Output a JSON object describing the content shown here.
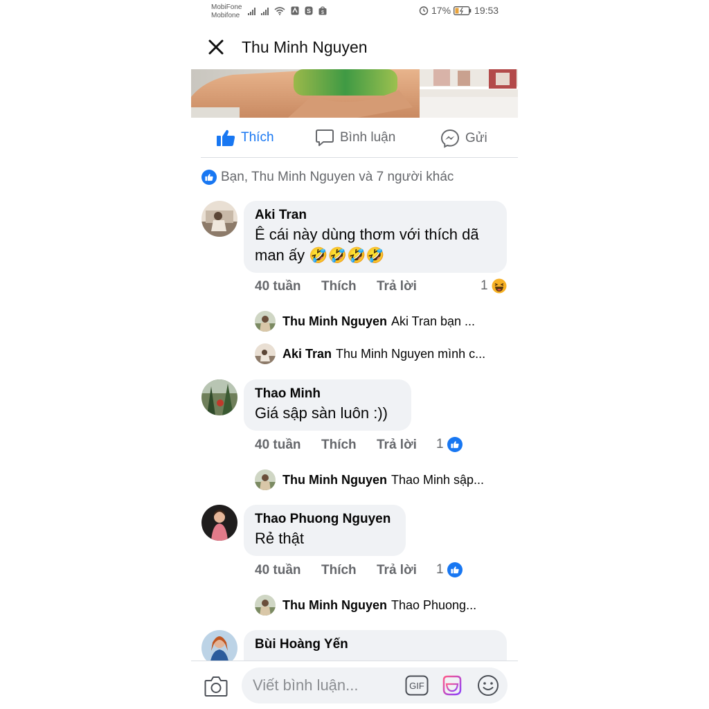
{
  "status_bar": {
    "carrier_1": "MobiFone",
    "carrier_2": "Mobifone",
    "battery": "17%",
    "time": "19:53"
  },
  "header": {
    "title": "Thu Minh Nguyen",
    "close_icon": "close-icon"
  },
  "actions": {
    "like": "Thích",
    "comment": "Bình luận",
    "send": "Gửi"
  },
  "likes_summary": "Bạn, Thu Minh Nguyen và 7 người khác",
  "comments": [
    {
      "author": "Aki Tran",
      "text": "Ê cái này dùng thơm với thích dã man ấy 🤣🤣🤣🤣",
      "time": "40 tuần",
      "like": "Thích",
      "reply": "Trả lời",
      "reaction_count": "1",
      "reaction": "haha",
      "replies": [
        {
          "author": "Thu Minh Nguyen",
          "preview": "Aki Tran  bạn ..."
        },
        {
          "author": "Aki Tran",
          "preview": "Thu Minh Nguyen mình c..."
        }
      ]
    },
    {
      "author": "Thao Minh",
      "text": "Giá sập sàn luôn :))",
      "time": "40 tuần",
      "like": "Thích",
      "reply": "Trả lời",
      "reaction_count": "1",
      "reaction": "like",
      "replies": [
        {
          "author": "Thu Minh Nguyen",
          "preview": "Thao Minh sập..."
        }
      ]
    },
    {
      "author": "Thao Phuong Nguyen",
      "text": "Rẻ thật",
      "time": "40 tuần",
      "like": "Thích",
      "reply": "Trả lời",
      "reaction_count": "1",
      "reaction": "like",
      "replies": [
        {
          "author": "Thu Minh Nguyen",
          "preview": "Thao Phuong..."
        }
      ]
    },
    {
      "author": "Bùi Hoàng Yến"
    }
  ],
  "composer": {
    "placeholder": "Viết bình luận...",
    "gif_label": "GIF"
  },
  "colors": {
    "brand_blue": "#1877f2",
    "bubble_bg": "#f0f2f5",
    "meta_gray": "#65676b"
  }
}
